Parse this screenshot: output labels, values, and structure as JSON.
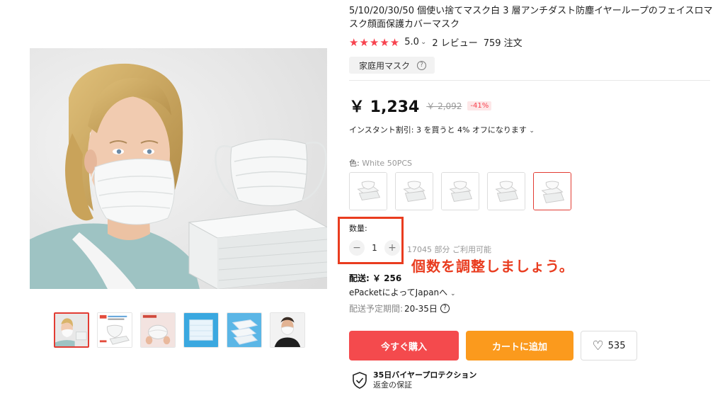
{
  "product": {
    "title": "5/10/20/30/50 個使い捨てマスク白 3 層アンチダスト防塵イヤーループのフェイスロマスク顔面保護カバーマスク",
    "stars": "★★★★★",
    "rating": "5.0",
    "reviews": "2 レビュー",
    "orders": "759 注文",
    "category_tag": "家庭用マスク"
  },
  "price": {
    "current": "￥ 1,234",
    "original": "￥ 2,092",
    "discount": "-41%",
    "instant_discount": "インスタント割引: 3 を買うと 4% オフになります"
  },
  "color": {
    "label": "色:",
    "selected": "White 50PCS",
    "swatch_count": 5,
    "selected_index": 4
  },
  "quantity": {
    "label": "数量:",
    "value": "1",
    "minus": "−",
    "plus": "+",
    "stock": "17045 部分 ご利用可能"
  },
  "annotation": {
    "text": "個数を調整しましょう。",
    "color": "#e93c1f"
  },
  "shipping": {
    "label": "配送: ￥ 256",
    "method": "ePacketによってJapanへ",
    "time_label": "配送予定期間:",
    "time_value": "20-35日"
  },
  "buttons": {
    "buy_now": "今すぐ購入",
    "add_to_cart": "カートに追加",
    "wishlist_count": "535"
  },
  "protection": {
    "title": "35日バイヤープロテクション",
    "subtitle": "返金の保証"
  },
  "gallery": {
    "thumbnail_count": 6,
    "active_index": 0
  },
  "colors": {
    "accent_red": "#f44a4d",
    "accent_orange": "#fb9a1d",
    "star_red": "#f7434f",
    "highlight_box": "#e93c1f"
  }
}
